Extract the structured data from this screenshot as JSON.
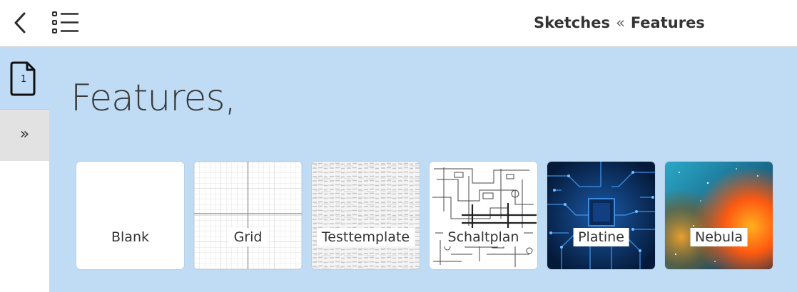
{
  "header": {
    "breadcrumb": {
      "parent": "Sketches",
      "separator": "«",
      "current": "Features"
    },
    "icons": {
      "back": "chevron-left-icon",
      "list": "list-icon"
    }
  },
  "sidebar": {
    "page_number": "1",
    "expand_glyph": "»",
    "icons": {
      "page": "document-icon",
      "expand": "double-chevron-right-icon"
    }
  },
  "main": {
    "heading": "Features,",
    "templates": [
      {
        "label": "Blank"
      },
      {
        "label": "Grid"
      },
      {
        "label": "Testtemplate"
      },
      {
        "label": "Schaltplan"
      },
      {
        "label": "Platine"
      },
      {
        "label": "Nebula"
      }
    ]
  },
  "colors": {
    "main_background": "#c0dcf5",
    "sidebar_active": "#bfdbf5",
    "sidebar_expand": "#e2e2e2"
  }
}
